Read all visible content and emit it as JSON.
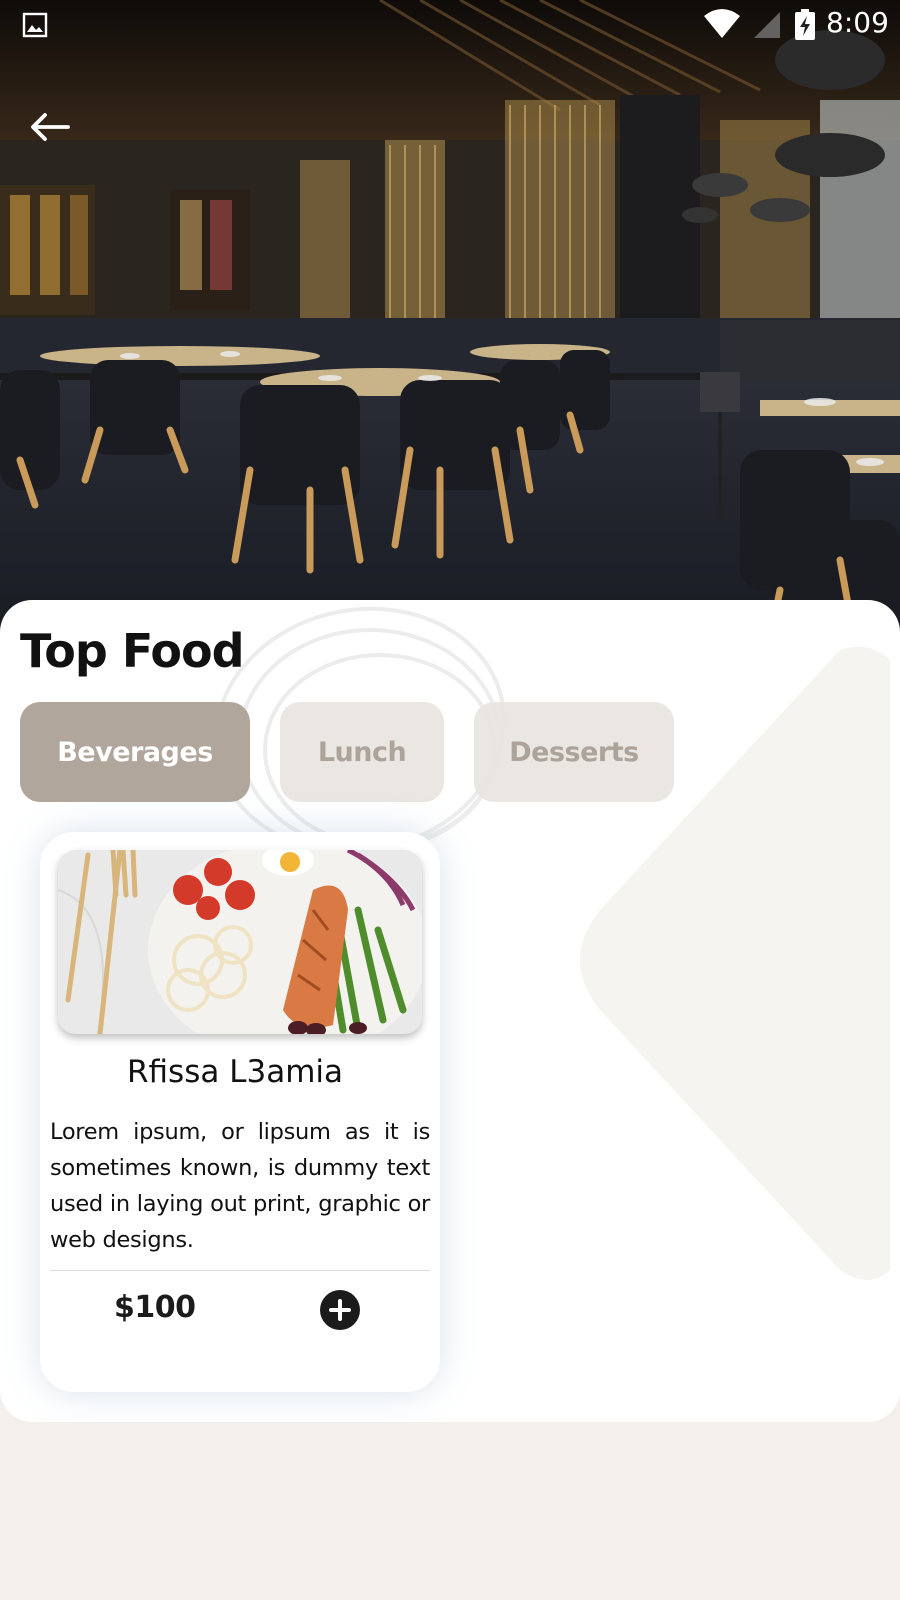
{
  "status_bar": {
    "time": "8:09",
    "icons": [
      "gallery-icon",
      "wifi-icon",
      "signal-icon",
      "battery-charging-icon"
    ]
  },
  "header": {
    "back_icon": "arrow-left-icon",
    "hero_image": "restaurant-interior-photo"
  },
  "main": {
    "title": "Top Food",
    "tabs": [
      {
        "label": "Beverages",
        "active": true
      },
      {
        "label": "Lunch",
        "active": false
      },
      {
        "label": "Desserts",
        "active": false
      }
    ],
    "items": [
      {
        "image": "salmon-salad-photo",
        "name": "Rfissa L3amia",
        "description": "Lorem ipsum, or lipsum as it is sometimes known, is dummy text used in laying out print, graphic or web designs.",
        "price": "$100",
        "add_icon": "plus-circle-icon"
      }
    ]
  },
  "colors": {
    "tab_active_bg": "#b0a69c",
    "tab_inactive_bg": "#e8e4e0",
    "tab_inactive_text": "#aca39a",
    "page_bg": "#f2efec",
    "add_button": "#1b1b1b"
  }
}
